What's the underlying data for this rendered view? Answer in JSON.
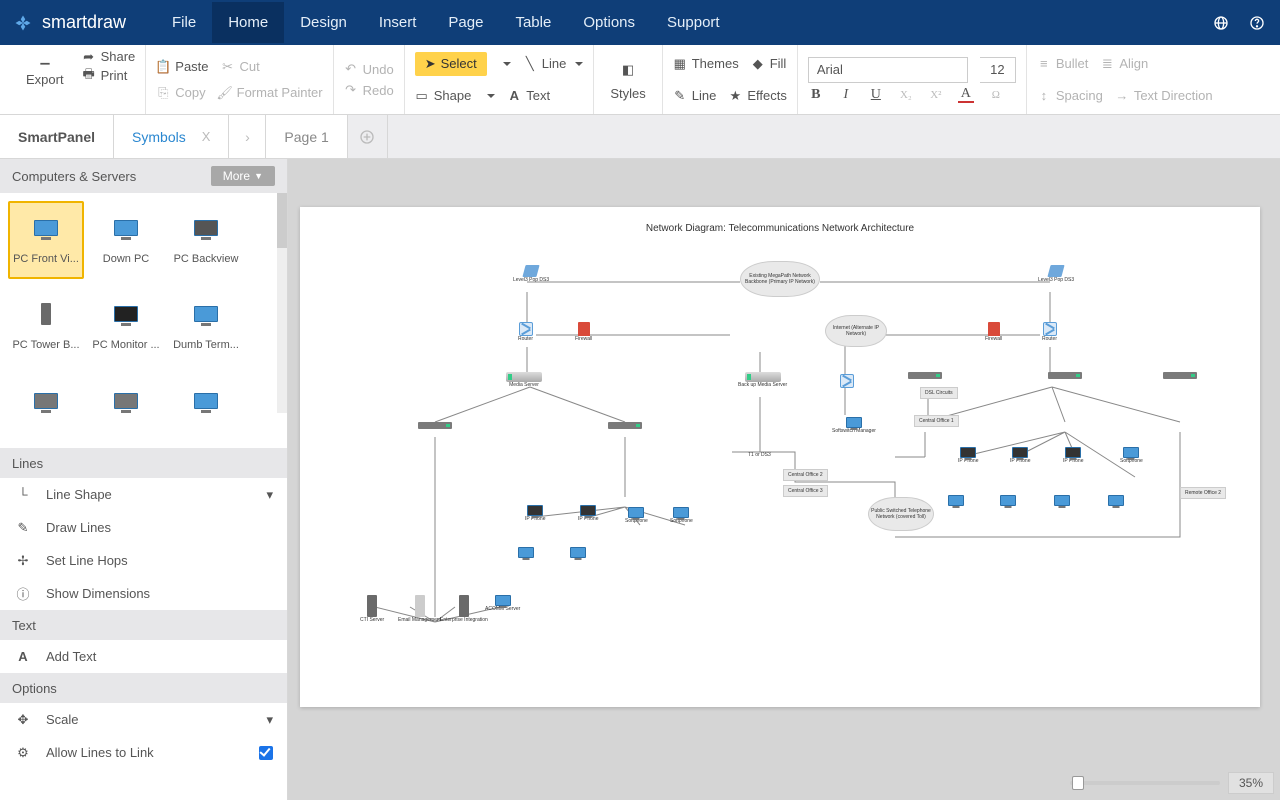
{
  "brand": "smartdraw",
  "nav": [
    "File",
    "Home",
    "Design",
    "Insert",
    "Page",
    "Table",
    "Options",
    "Support"
  ],
  "nav_active": 1,
  "ribbon": {
    "export": "Export",
    "share": "Share",
    "print": "Print",
    "paste": "Paste",
    "cut": "Cut",
    "copy": "Copy",
    "format_painter": "Format Painter",
    "undo": "Undo",
    "redo": "Redo",
    "select": "Select",
    "shape": "Shape",
    "line": "Line",
    "text": "Text",
    "styles": "Styles",
    "themes": "Themes",
    "fill": "Fill",
    "line2": "Line",
    "effects": "Effects",
    "font": "Arial",
    "font_size": "12",
    "bullet": "Bullet",
    "align": "Align",
    "spacing": "Spacing",
    "text_direction": "Text Direction"
  },
  "tabs": {
    "smartpanel": "SmartPanel",
    "symbols": "Symbols",
    "page1": "Page 1"
  },
  "library": {
    "name": "Computers & Servers",
    "more": "More",
    "items": [
      "PC Front Vi...",
      "Down PC",
      "PC Backview",
      "PC Tower B...",
      "PC Monitor ...",
      "Dumb Term...",
      "",
      "",
      ""
    ],
    "selected": 0
  },
  "lines_section": {
    "title": "Lines",
    "items": [
      "Line Shape",
      "Draw Lines",
      "Set Line Hops",
      "Show Dimensions"
    ]
  },
  "text_section": {
    "title": "Text",
    "items": [
      "Add Text"
    ]
  },
  "options_section": {
    "title": "Options",
    "items": [
      "Scale",
      "Allow Lines to Link"
    ]
  },
  "diagram": {
    "title": "Network Diagram: Telecommunications Network Architecture",
    "nodes": {
      "modem_l": "Level3 Pop DS3",
      "modem_r": "Level3 Pop DS3",
      "router_l": "Router",
      "router_r": "Router",
      "fw_l": "Firewall",
      "fw_r": "Firewall",
      "cloud_top": "Existing MegaPath Network Backbone (Primary IP Network)",
      "cloud_mid": "Internet (Alternate IP Network)",
      "cloud_bot": "Public Switched Telephone Network (covered Toll)",
      "media_l": "Media Server",
      "media_r": "Back up Media Server",
      "sw_manager": "Softswitch Manager",
      "dsl": "DSL Circuits",
      "central1": "Central Office 1",
      "central2": "Central Office 2",
      "central3": "Central Office 3",
      "remote2": "Remote Office 2",
      "t1": "T1 or DS3",
      "ipphone": "IP Phone",
      "softphone": "Softphone",
      "cti": "CTI Server",
      "email": "Email Management",
      "enterprise": "Enterprise Integration",
      "acomm": "ACOMM Server"
    }
  },
  "zoom": "35%"
}
